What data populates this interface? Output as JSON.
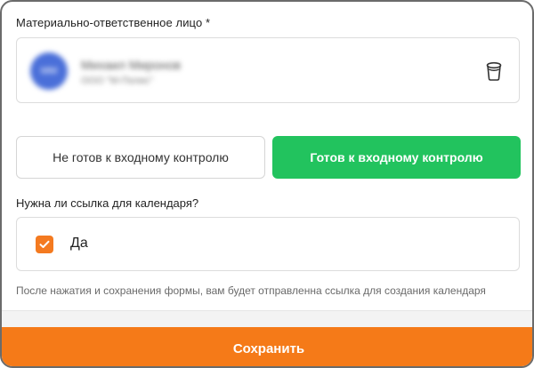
{
  "responsible_person": {
    "label": "Материально-ответственное лицо",
    "required_mark": "*",
    "avatar_initials": "ММ",
    "name": "Михаил Миронов",
    "org": "ООО \"М-Полис\""
  },
  "status": {
    "not_ready_label": "Не готов к входному контролю",
    "ready_label": "Готов к входному контролю",
    "selected": "ready"
  },
  "calendar": {
    "question": "Нужна ли ссылка для календаря?",
    "checkbox_label": "Да",
    "checked": true,
    "hint": "После нажатия и сохранения формы, вам будет отправленна ссылка для создания календаря"
  },
  "footer": {
    "save_label": "Сохранить"
  },
  "colors": {
    "accent_orange": "#f57a18",
    "ready_green": "#22c35e",
    "checkbox_orange": "#f47a20"
  },
  "icons": {
    "trash": "trash-icon",
    "check": "check-icon"
  }
}
